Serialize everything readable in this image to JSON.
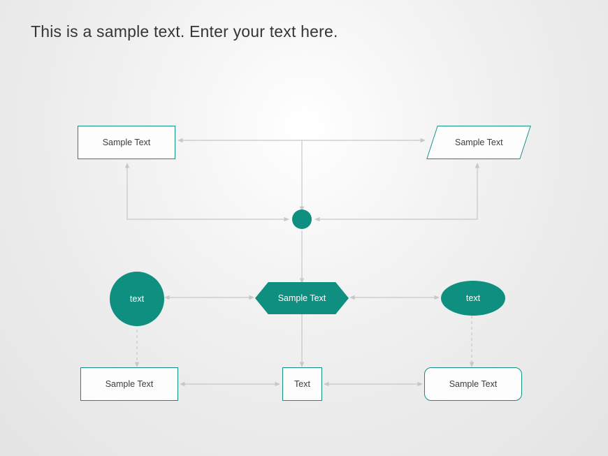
{
  "title": "This is a sample text. Enter your text here.",
  "colors": {
    "accent": "#0f8f80",
    "text": "#3d3d3d",
    "bg": "#ffffff"
  },
  "nodes": {
    "top_left_rect": "Sample Text",
    "top_right_para": "Sample Text",
    "mid_circle": "text",
    "mid_hex": "Sample Text",
    "mid_ellipse": "text",
    "bot_left_rect": "Sample Text",
    "bot_mid_square": "Text",
    "bot_right_round": "Sample Text"
  }
}
